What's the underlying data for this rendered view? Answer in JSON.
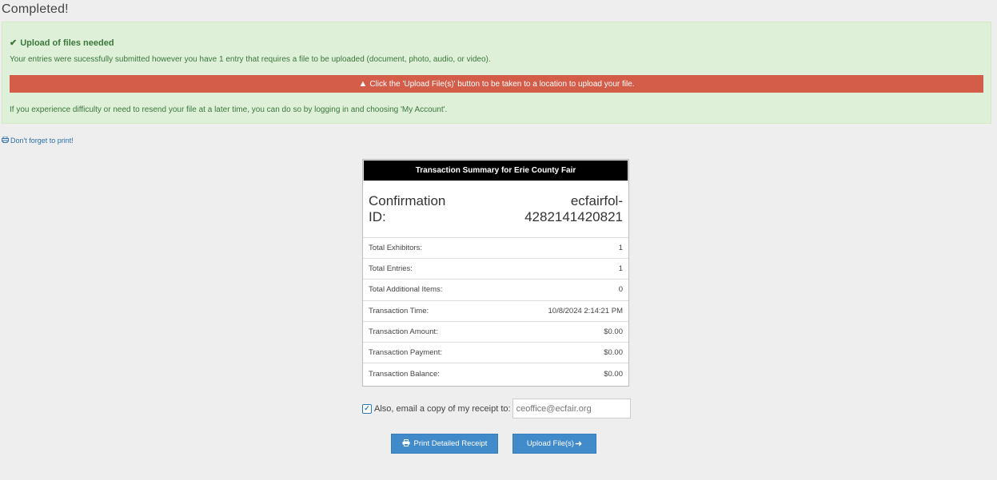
{
  "page": {
    "title": "Completed!"
  },
  "alert": {
    "heading": "Upload of files needed",
    "message1": "Your entries were sucessfully submitted however you have 1 entry that requires a file to be uploaded (document, photo, audio, or video).",
    "warning": "Click the 'Upload File(s)' button to be taken to a location to upload your file.",
    "message2": "If you experience difficulty or need to resend your file at a later time, you can do so by logging in and choosing 'My Account'.",
    "bg_color": "#dff0d8",
    "warning_color": "#d45d49"
  },
  "print_link": {
    "label": "Don't forget to print!"
  },
  "summary": {
    "header": "Transaction Summary for Erie County Fair",
    "confirmation_label_line1": "Confirmation",
    "confirmation_label_line2": "ID:",
    "confirmation_value_line1": "ecfairfol-",
    "confirmation_value_line2": "4282141420821",
    "rows": [
      {
        "label": "Total Exhibitors:",
        "value": "1"
      },
      {
        "label": "Total Entries:",
        "value": "1"
      },
      {
        "label": "Total Additional Items:",
        "value": "0"
      },
      {
        "label": "Transaction Time:",
        "value": "10/8/2024 2:14:21 PM"
      },
      {
        "label": "Transaction Amount:",
        "value": "$0.00"
      },
      {
        "label": "Transaction Payment:",
        "value": "$0.00"
      },
      {
        "label": "Transaction Balance:",
        "value": "$0.00"
      }
    ]
  },
  "email": {
    "label": "Also, email a copy of my receipt to:",
    "value": "ceoffice@ecfair.org",
    "checked": true
  },
  "buttons": {
    "print_label": "Print Detailed Receipt",
    "upload_label": "Upload File(s)",
    "color": "#428bca"
  },
  "icons": {
    "check": "check-icon",
    "warning": "warning-triangle-icon",
    "print": "printer-icon",
    "arrow": "arrow-right-icon"
  }
}
